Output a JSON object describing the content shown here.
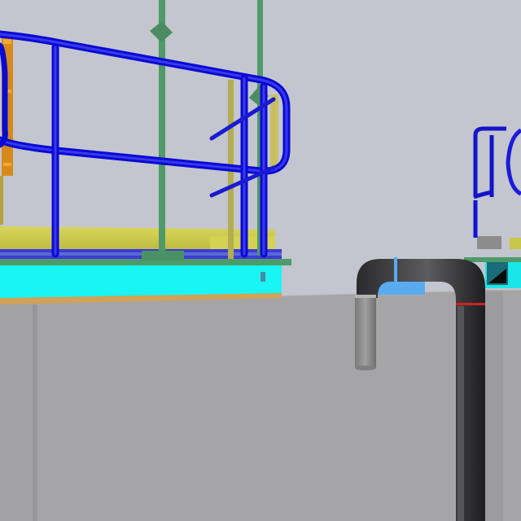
{
  "scene": {
    "kind": "3d-cad-plant-model-viewport",
    "background_color": "#c3c6cf",
    "colors": {
      "wall": "#a4a4a6",
      "wall_shade": "#9a9a9c",
      "platform_cyan": "#19f4f4",
      "grating_yellow": "#c9c748",
      "handrail_blue": "#1010e6",
      "column_green": "#4f9a69",
      "ladder_orange": "#d7891a",
      "pipe_dark": "#3c3c3e",
      "pipe_inner_grey": "#8e8e8e",
      "pipe_flange_red": "#cc2222",
      "pipe_flange_blue": "#5aaaf0"
    },
    "objects": [
      "concrete-wall",
      "cyan-platform-edge",
      "yellow-grating",
      "blue-handrail",
      "green-column",
      "orange-ladder",
      "dark-pipe-u-bend",
      "background-handrail"
    ]
  }
}
